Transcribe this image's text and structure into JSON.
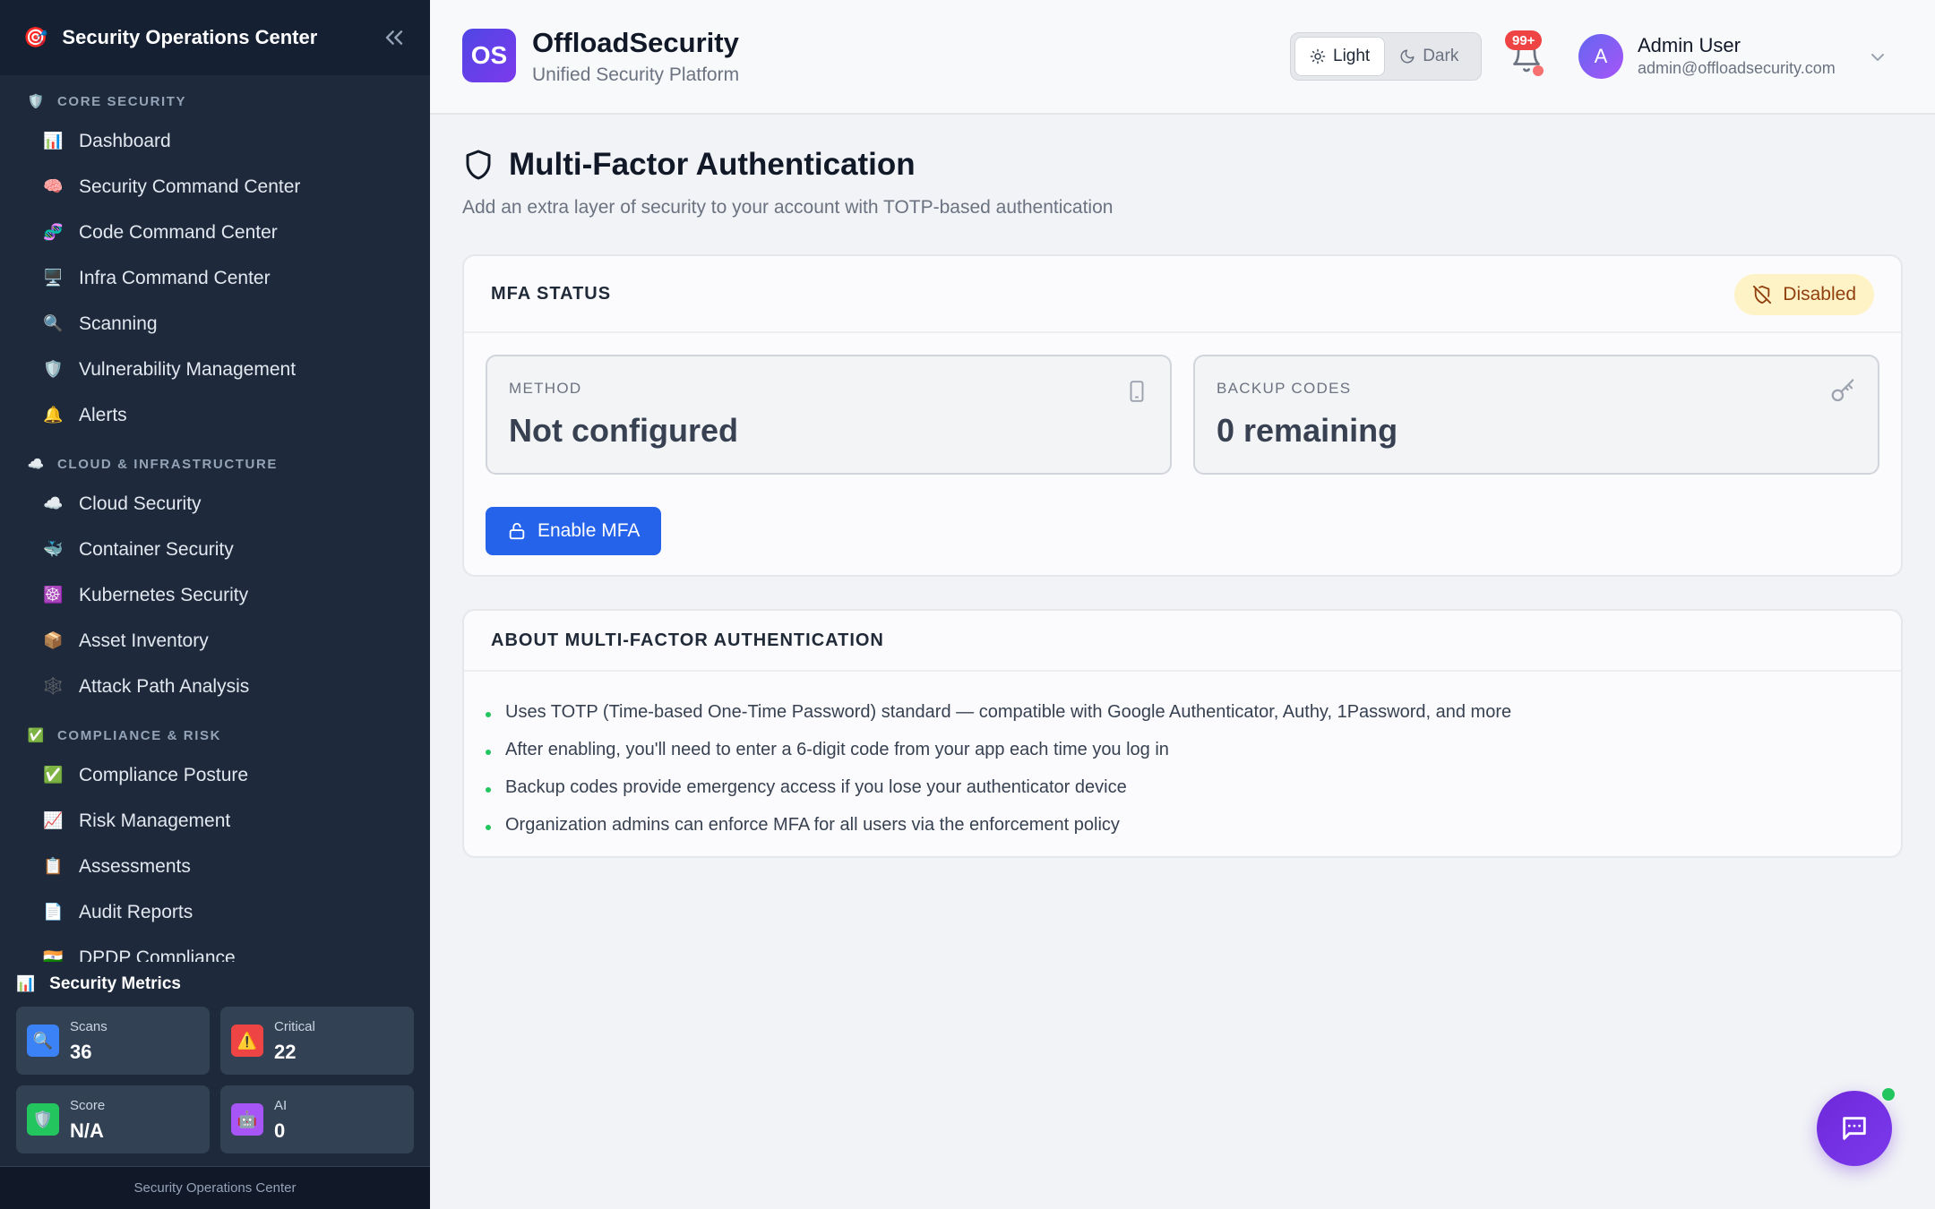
{
  "sidebar": {
    "title": "Security Operations Center",
    "logo_emoji": "🎯",
    "sections": [
      {
        "label": "CORE SECURITY",
        "icon": "🛡️",
        "items": [
          {
            "icon": "📊",
            "label": "Dashboard"
          },
          {
            "icon": "🧠",
            "label": "Security Command Center"
          },
          {
            "icon": "🧬",
            "label": "Code Command Center"
          },
          {
            "icon": "🖥️",
            "label": "Infra Command Center"
          },
          {
            "icon": "🔍",
            "label": "Scanning"
          },
          {
            "icon": "🛡️",
            "label": "Vulnerability Management"
          },
          {
            "icon": "🔔",
            "label": "Alerts"
          }
        ]
      },
      {
        "label": "CLOUD & INFRASTRUCTURE",
        "icon": "☁️",
        "items": [
          {
            "icon": "☁️",
            "label": "Cloud Security"
          },
          {
            "icon": "🐳",
            "label": "Container Security"
          },
          {
            "icon": "☸️",
            "label": "Kubernetes Security"
          },
          {
            "icon": "📦",
            "label": "Asset Inventory"
          },
          {
            "icon": "🕸️",
            "label": "Attack Path Analysis"
          }
        ]
      },
      {
        "label": "COMPLIANCE & RISK",
        "icon": "✅",
        "items": [
          {
            "icon": "✅",
            "label": "Compliance Posture"
          },
          {
            "icon": "📈",
            "label": "Risk Management"
          },
          {
            "icon": "📋",
            "label": "Assessments"
          },
          {
            "icon": "📄",
            "label": "Audit Reports"
          },
          {
            "icon": "🇮🇳",
            "label": "DPDP Compliance"
          }
        ]
      }
    ],
    "metrics": {
      "title": "Security Metrics",
      "icon": "📊",
      "cards": [
        {
          "label": "Scans",
          "value": "36",
          "icon": "🔍",
          "color": "#3b82f6"
        },
        {
          "label": "Critical",
          "value": "22",
          "icon": "⚠️",
          "color": "#ef4444"
        },
        {
          "label": "Score",
          "value": "N/A",
          "icon": "🛡️",
          "color": "#22c55e"
        },
        {
          "label": "AI",
          "value": "0",
          "icon": "🤖",
          "color": "#a855f7"
        }
      ]
    },
    "footer": "Security Operations Center"
  },
  "header": {
    "logo_text": "OS",
    "brand": "OffloadSecurity",
    "tagline": "Unified Security Platform",
    "theme": {
      "light": "Light",
      "dark": "Dark",
      "active": "light"
    },
    "notifications": "99+",
    "avatar_initial": "A",
    "user_name": "Admin User",
    "user_email": "admin@offloadsecurity.com"
  },
  "page": {
    "title": "Multi-Factor Authentication",
    "description": "Add an extra layer of security to your account with TOTP-based authentication"
  },
  "status_card": {
    "title": "MFA STATUS",
    "status": "Disabled",
    "method_label": "METHOD",
    "method_value": "Not configured",
    "backup_label": "BACKUP CODES",
    "backup_value": "0 remaining",
    "enable_button": "Enable MFA"
  },
  "about_card": {
    "title": "ABOUT MULTI-FACTOR AUTHENTICATION",
    "points": [
      "Uses TOTP (Time-based One-Time Password) standard — compatible with Google Authenticator, Authy, 1Password, and more",
      "After enabling, you'll need to enter a 6-digit code from your app each time you log in",
      "Backup codes provide emergency access if you lose your authenticator device",
      "Organization admins can enforce MFA for all users via the enforcement policy"
    ]
  },
  "colors": {
    "sidebar_bg": "#1e293b",
    "accent": "#2563eb",
    "brand_gradient_start": "#4f46e5",
    "status_disabled_bg": "#fef3c7",
    "status_disabled_fg": "#92400e",
    "online": "#22c55e"
  }
}
